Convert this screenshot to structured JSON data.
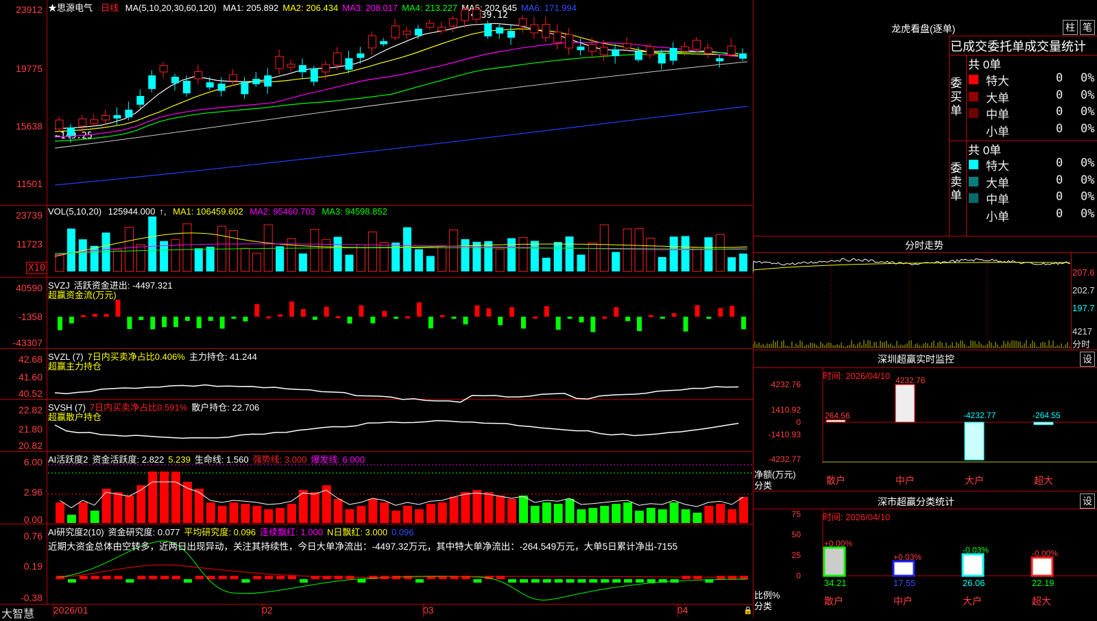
{
  "stock": {
    "name": "思源电气",
    "period": "日线"
  },
  "kline": {
    "ylabels": [
      "23912",
      "19775",
      "15638",
      "11501"
    ],
    "ma_title": "MA(5,10,20,30,60,120)",
    "ma": [
      {
        "label": "MA1: 205.892",
        "color": "#ffffff"
      },
      {
        "label": "MA2: 206.434",
        "color": "#ffff00"
      },
      {
        "label": "MA3: 208.017",
        "color": "#ff00ff"
      },
      {
        "label": "MA4: 213.227",
        "color": "#00ff00"
      },
      {
        "label": "MA5: 202.645",
        "color": "#ffffff"
      },
      {
        "label": "MA6: 171.994",
        "color": "#3050ff"
      }
    ],
    "high_label": "239.12",
    "low_label": "149.25"
  },
  "volume": {
    "ylabels": [
      "23739",
      "11723"
    ],
    "unit": "X10",
    "title": "VOL(5,10,20)",
    "value": "125944.000",
    "ma1": "MA1: 106459.602",
    "ma2": "MA2: 95460.703",
    "ma3": "MA3: 94598.852"
  },
  "svzj": {
    "ylabels": [
      "40590",
      "-1358",
      "-43307"
    ],
    "title": "SVZJ",
    "value": "活跃资金进出: -4497.321",
    "sub": "超赢资金流(万元)"
  },
  "svzl": {
    "ylabels": [
      "42.68",
      "41.60",
      "40.52"
    ],
    "title": "SVZL (7)",
    "ratio": "7日内买卖净占比0.406%",
    "hold": "主力持仓: 41.244",
    "sub": "超赢主力持仓"
  },
  "svsh": {
    "ylabels": [
      "22.82",
      "21.80",
      "20.82"
    ],
    "title": "SVSH (7)",
    "ratio": "7日内买卖净占比0.591%",
    "hold": "散户持仓: 22.706",
    "sub": "超赢散户持仓"
  },
  "ai1": {
    "ylabels": [
      "6.00",
      "2.96",
      "0.00"
    ],
    "title": "AI活跃度2",
    "v1": "资金活跃度: 2.822",
    "v2": "5.239",
    "v3": "生命线: 1.560",
    "v4": "强势线: 3.000",
    "v5": "爆发线: 6.000"
  },
  "ai2": {
    "ylabels": [
      "0.76",
      "0.19",
      "-0.38"
    ],
    "title": "AI研究度2(10)",
    "v1": "资金研究度: 0.077",
    "v2": "平均研究度: 0.096",
    "v3": "连续飘红: 1.000",
    "v4": "N日飘红: 3.000",
    "v5": "0.096",
    "comment": "近期大资金总体由空转多，近两日出现异动，关注其持续性，今日大单净流出：-4497.32万元，其中特大单净流出：-264.549万元，大单5日累计净出-7155"
  },
  "xaxis": {
    "labels": [
      "2026/01",
      "02",
      "03",
      "04"
    ],
    "brand": "大智慧"
  },
  "lhb": {
    "title": "龙虎看盘(逐单)",
    "btn1": "柱",
    "btn2": "笔",
    "subtitle": "已成交委托单成交量统计",
    "buy_label": "委买单",
    "sell_label": "委卖单",
    "buy_total": "共 0单",
    "sell_total": "共 0单",
    "buy_rows": [
      {
        "name": "特大",
        "val": "0",
        "pct": "0%",
        "color": "#ff0000"
      },
      {
        "name": "大单",
        "val": "0",
        "pct": "0%",
        "color": "#900000"
      },
      {
        "name": "中单",
        "val": "0",
        "pct": "0%",
        "color": "#700000"
      },
      {
        "name": "小单",
        "val": "0",
        "pct": "0%",
        "color": ""
      }
    ],
    "sell_rows": [
      {
        "name": "特大",
        "val": "0",
        "pct": "0%",
        "color": "#00ffff"
      },
      {
        "name": "大单",
        "val": "0",
        "pct": "0%",
        "color": "#008080"
      },
      {
        "name": "中单",
        "val": "0",
        "pct": "0%",
        "color": "#006a6a"
      },
      {
        "name": "小单",
        "val": "0",
        "pct": "0%",
        "color": ""
      }
    ]
  },
  "fenshi": {
    "title": "分时走势",
    "ylabels": [
      "207.6",
      "202.7",
      "197.7",
      "4217"
    ],
    "unit": "分时"
  },
  "monitor": {
    "title": "深圳超赢实时监控",
    "btn": "设",
    "time": "时间: 2026/04/10",
    "ylabels": [
      "4232.76",
      "1410.92",
      "0",
      "-1410.93",
      "-4232.77"
    ],
    "unit": "净额(万元)",
    "cat_label": "分类",
    "bars": [
      {
        "name": "散户",
        "value": 264.56,
        "label": "264.56"
      },
      {
        "name": "中户",
        "value": 4232.76,
        "label": "4232.76"
      },
      {
        "name": "大户",
        "value": -4232.77,
        "label": "-4232.77"
      },
      {
        "name": "超大",
        "value": -264.55,
        "label": "-264.55"
      }
    ]
  },
  "classify": {
    "title": "深市超赢分类统计",
    "btn": "设",
    "time": "时间: 2026/04/10",
    "ylabels": [
      "75",
      "50",
      "25",
      "0"
    ],
    "unit": "比例%",
    "cat_label": "分类",
    "bars": [
      {
        "name": "散户",
        "value": 34.21,
        "label": "34.21",
        "chg": "+0.00%"
      },
      {
        "name": "中户",
        "value": 17.55,
        "label": "17.55",
        "chg": "+0.03%"
      },
      {
        "name": "大户",
        "value": 26.06,
        "label": "26.06",
        "chg": "-0.03%"
      },
      {
        "name": "超大",
        "value": 22.19,
        "label": "22.19",
        "chg": "-0.00%"
      }
    ]
  }
}
